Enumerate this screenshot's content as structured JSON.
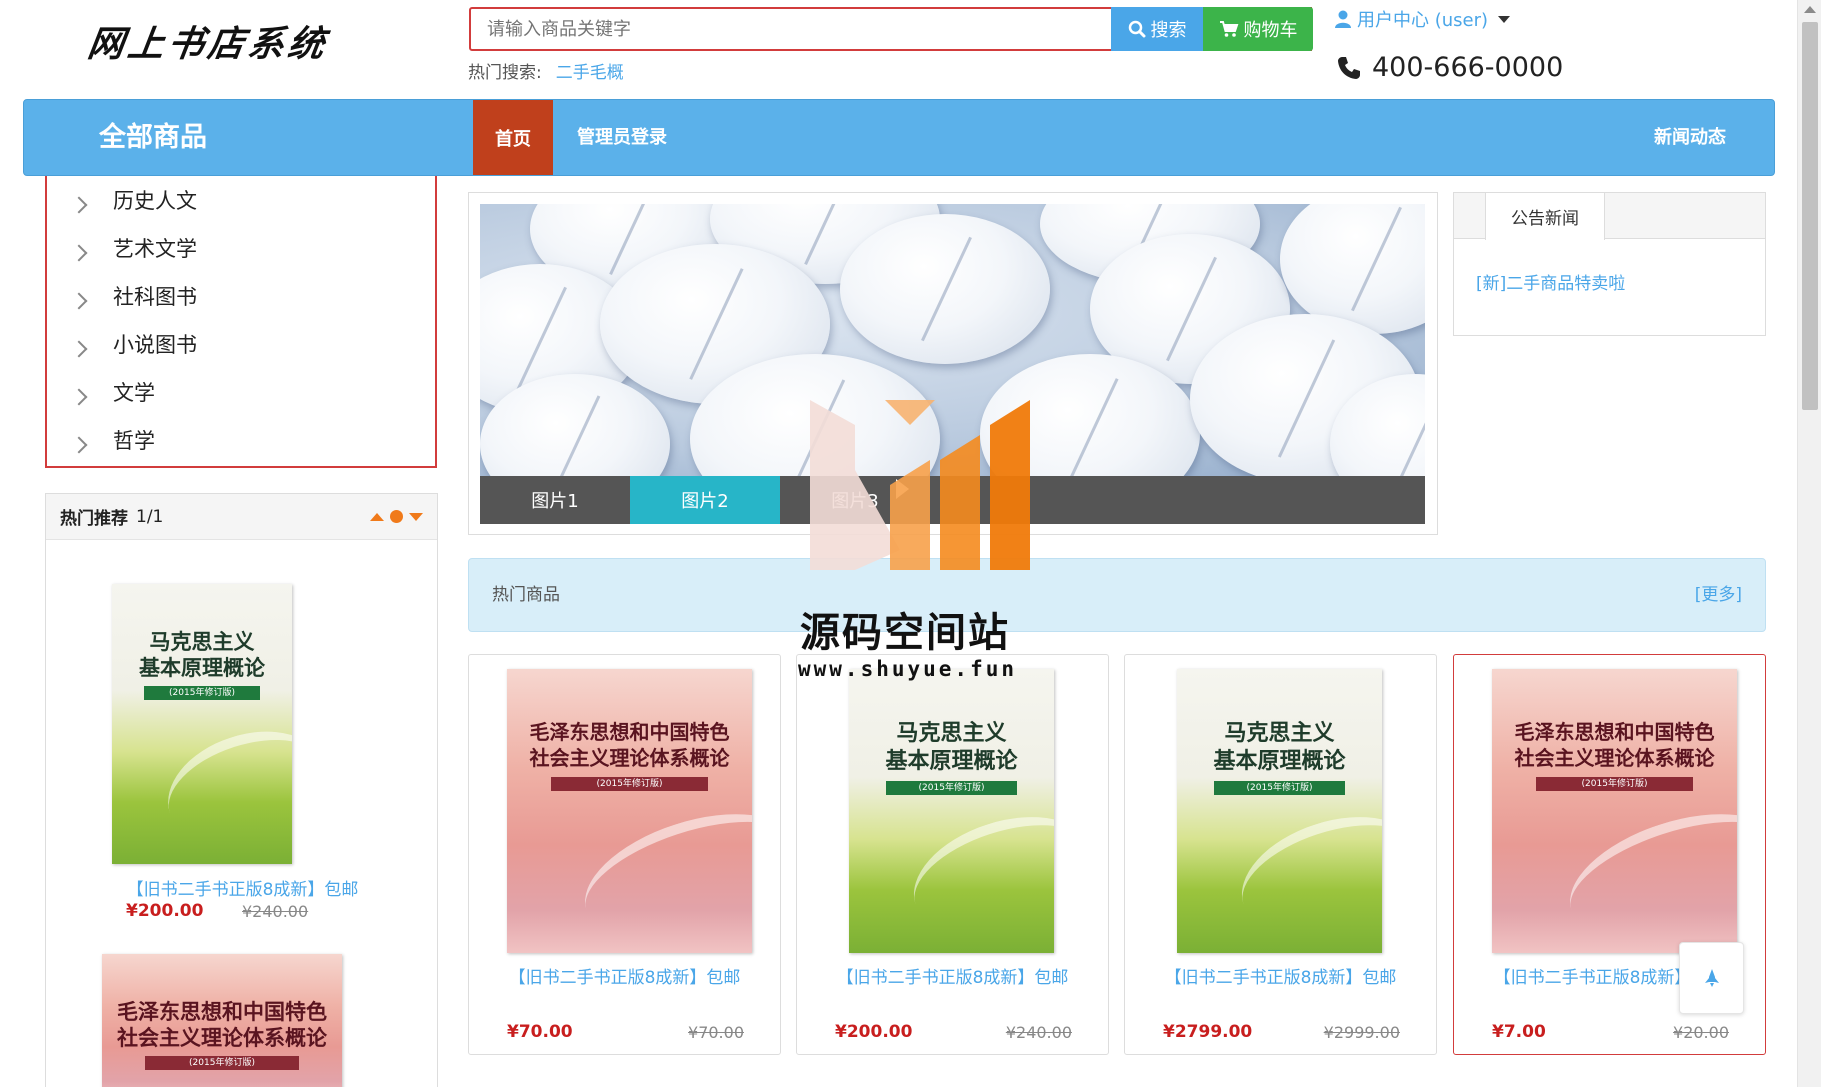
{
  "header": {
    "logo": "网上书店系统",
    "search_placeholder": "请输入商品关键字",
    "search_label": "搜索",
    "cart_label": "购物车",
    "hot_search_label": "热门搜索:",
    "hot_search_items": [
      "二手毛概"
    ],
    "user_center_label": "用户中心 (user)",
    "phone": "400-666-0000"
  },
  "nav": {
    "all_goods": "全部商品",
    "home": "首页",
    "admin_login": "管理员登录",
    "news": "新闻动态"
  },
  "categories": [
    "历史人文",
    "艺术文学",
    "社科图书",
    "小说图书",
    "文学",
    "哲学"
  ],
  "hot_recommend": {
    "title": "热门推荐",
    "page": "1/1",
    "items": [
      {
        "title": "【旧书二手书正版8成新】包邮",
        "price": "¥200.00",
        "old_price": "¥240.00",
        "cover_l1": "马克思主义",
        "cover_l2": "基本原理概论",
        "cover_band": "(2015年修订版)"
      },
      {
        "cover_l1": "毛泽东思想和中国特色",
        "cover_l2": "社会主义理论体系概论",
        "cover_band": "(2015年修订版)"
      }
    ]
  },
  "banner": {
    "tabs": [
      "图片1",
      "图片2",
      "图片3"
    ],
    "active_tab": 1
  },
  "notice": {
    "tab": "公告新闻",
    "items": [
      "[新]二手商品特卖啦"
    ]
  },
  "hot_goods": {
    "title": "热门商品",
    "more": "[更多]",
    "products": [
      {
        "title": "【旧书二手书正版8成新】包邮",
        "price": "¥70.00",
        "old_price": "¥70.00",
        "cover_l1": "毛泽东思想和中国特色",
        "cover_l2": "社会主义理论体系概论",
        "cover_band": "(2015年修订版)"
      },
      {
        "title": "【旧书二手书正版8成新】包邮",
        "price": "¥200.00",
        "old_price": "¥240.00",
        "cover_l1": "马克思主义",
        "cover_l2": "基本原理概论",
        "cover_band": "(2015年修订版)"
      },
      {
        "title": "【旧书二手书正版8成新】包邮",
        "price": "¥2799.00",
        "old_price": "¥2999.00",
        "cover_l1": "马克思主义",
        "cover_l2": "基本原理概论",
        "cover_band": "(2015年修订版)"
      },
      {
        "title": "【旧书二手书正版8成新】包邮",
        "price": "¥7.00",
        "old_price": "¥20.00",
        "cover_l1": "毛泽东思想和中国特色",
        "cover_l2": "社会主义理论体系概论",
        "cover_band": "(2015年修订版)"
      }
    ]
  },
  "watermark": {
    "text": "源码空间站",
    "url": "www.shuyue.fun"
  },
  "colors": {
    "nav_blue": "#5bb1ea",
    "home_red": "#c0401c",
    "search_border": "#d23c3c",
    "search_btn": "#4aa6e8",
    "cart_btn": "#3cb44a",
    "price_red": "#c81e1e",
    "link_blue": "#4aa6e8",
    "tab_active": "#27b5c8",
    "accent_orange": "#f07a1a"
  }
}
